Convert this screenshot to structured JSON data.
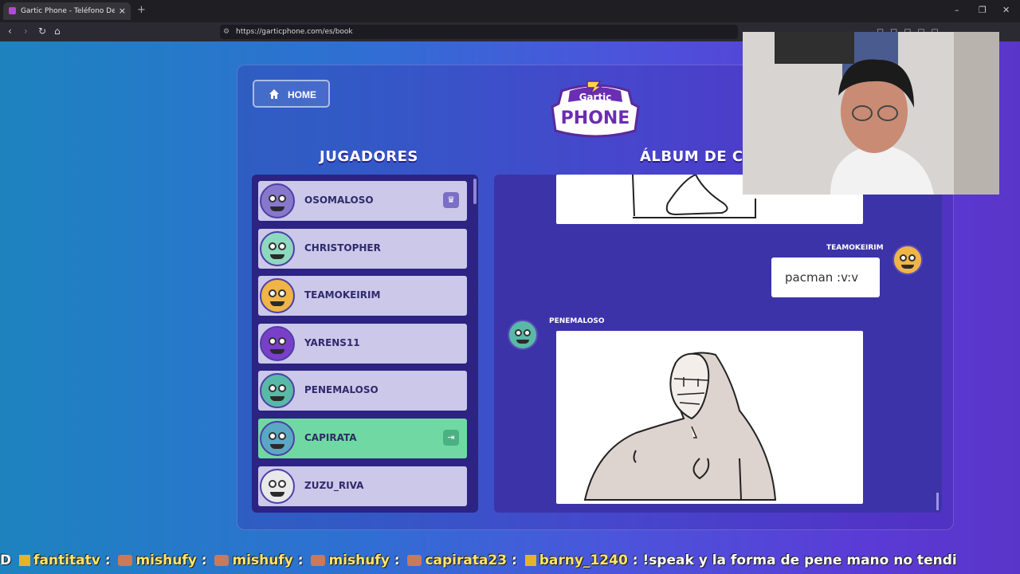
{
  "browser": {
    "tab_title": "Gartic Phone - Teléfono Descon",
    "tab_close": "×",
    "new_tab": "+",
    "url": "https://garticphone.com/es/book",
    "window_controls": [
      "–",
      "❐",
      "✕"
    ]
  },
  "game": {
    "home_label": "HOME",
    "logo_top": "Gartic",
    "logo_bottom": "PHONE",
    "players_title": "JUGADORES",
    "album_title": "ÁLBUM DE CA",
    "players": [
      {
        "name": "OSOMALOSO",
        "badge": "♛",
        "active": false
      },
      {
        "name": "CHRISTOPHER",
        "badge": "",
        "active": false
      },
      {
        "name": "TEAMOKEIRIM",
        "badge": "",
        "active": false
      },
      {
        "name": "YARENS11",
        "badge": "",
        "active": false
      },
      {
        "name": "PENEMALOSO",
        "badge": "",
        "active": false
      },
      {
        "name": "CAPIRATA",
        "badge": "⇥",
        "active": true
      },
      {
        "name": "ZUZU_RIVA",
        "badge": "",
        "active": false
      }
    ],
    "album": {
      "text_author": "TEAMOKEIRIM",
      "text_entry": "pacman :v:v",
      "drawing_author": "PENEMALOSO"
    }
  },
  "chat": {
    "prefix": "D",
    "segments": [
      {
        "user": "fantitatv",
        "sep": ":"
      },
      {
        "user": "mishufy",
        "sep": ":"
      },
      {
        "user": "mishufy",
        "sep": ":"
      },
      {
        "user": "mishufy",
        "sep": ":"
      },
      {
        "user": "capirata23",
        "sep": ":"
      },
      {
        "user": "barny_1240",
        "sep": ":"
      }
    ],
    "last_message": "!speak y la forma de pene mano no tendi"
  }
}
